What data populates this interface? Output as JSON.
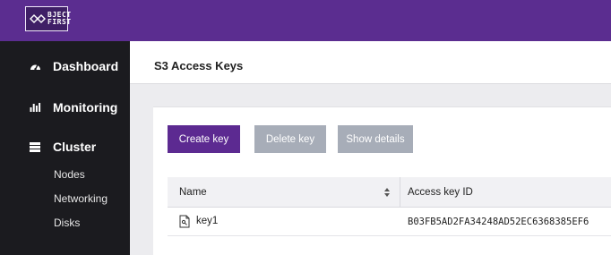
{
  "brand": {
    "logo_line1": "BJECT",
    "logo_line2": "FIRST",
    "color": "#5b2d90"
  },
  "sidebar": {
    "items": [
      {
        "label": "Dashboard",
        "icon": "dashboard-gauge-icon"
      },
      {
        "label": "Monitoring",
        "icon": "bar-chart-icon"
      },
      {
        "label": "Cluster",
        "icon": "server-stack-icon"
      }
    ],
    "subitems": [
      {
        "label": "Nodes"
      },
      {
        "label": "Networking"
      },
      {
        "label": "Disks"
      }
    ]
  },
  "page": {
    "title": "S3 Access Keys"
  },
  "toolbar": {
    "create_label": "Create key",
    "delete_label": "Delete key",
    "details_label": "Show details"
  },
  "table": {
    "columns": [
      {
        "label": "Name",
        "sortable": true
      },
      {
        "label": "Access key ID"
      }
    ],
    "rows": [
      {
        "name": "key1",
        "access_key_id": "B03FB5AD2FA34248AD52EC6368385EF6"
      }
    ]
  },
  "colors": {
    "accent": "#5c2a91",
    "disabled": "#a7adb8",
    "sidebar_bg": "#1b1b1f"
  }
}
